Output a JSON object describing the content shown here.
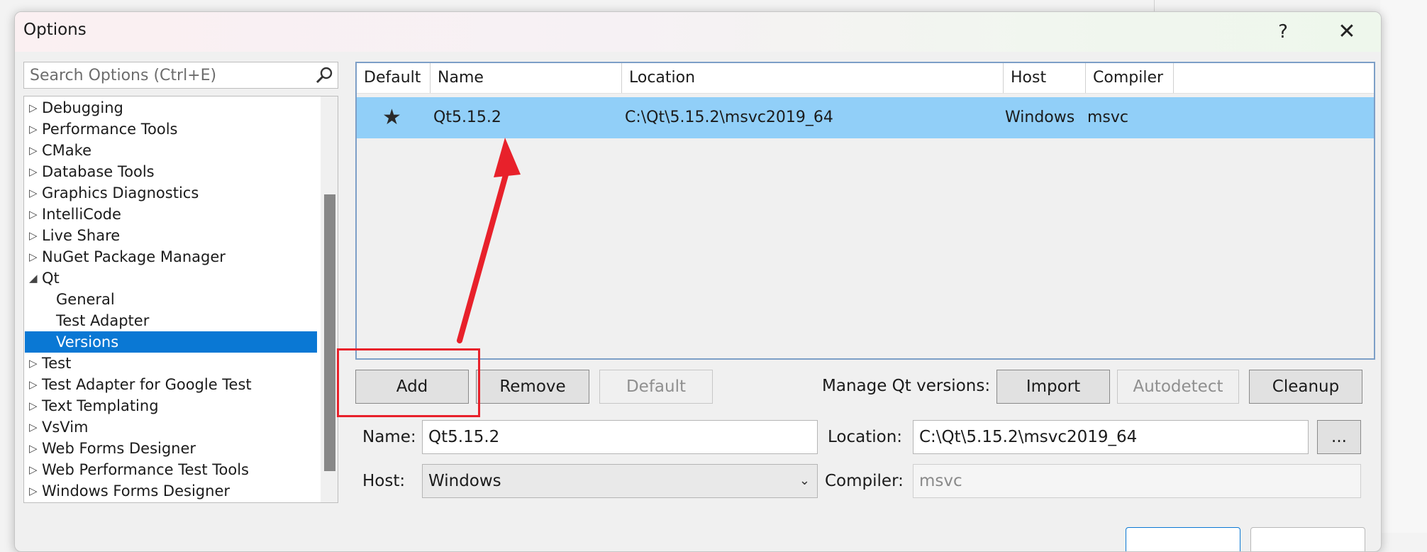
{
  "dialog": {
    "title": "Options",
    "help_label": "?",
    "close_label": "✕"
  },
  "search": {
    "placeholder": "Search Options (Ctrl+E)",
    "icon": "search-icon"
  },
  "tree": {
    "items": [
      {
        "label": "Debugging",
        "arrow": "▷",
        "level": 0
      },
      {
        "label": "Performance Tools",
        "arrow": "▷",
        "level": 0
      },
      {
        "label": "CMake",
        "arrow": "▷",
        "level": 0
      },
      {
        "label": "Database Tools",
        "arrow": "▷",
        "level": 0
      },
      {
        "label": "Graphics Diagnostics",
        "arrow": "▷",
        "level": 0
      },
      {
        "label": "IntelliCode",
        "arrow": "▷",
        "level": 0
      },
      {
        "label": "Live Share",
        "arrow": "▷",
        "level": 0
      },
      {
        "label": "NuGet Package Manager",
        "arrow": "▷",
        "level": 0
      },
      {
        "label": "Qt",
        "arrow": "◢",
        "level": 0
      },
      {
        "label": "General",
        "arrow": "",
        "level": 1
      },
      {
        "label": "Test Adapter",
        "arrow": "",
        "level": 1
      },
      {
        "label": "Versions",
        "arrow": "",
        "level": 1,
        "selected": true
      },
      {
        "label": "Test",
        "arrow": "▷",
        "level": 0
      },
      {
        "label": "Test Adapter for Google Test",
        "arrow": "▷",
        "level": 0
      },
      {
        "label": "Text Templating",
        "arrow": "▷",
        "level": 0
      },
      {
        "label": "VsVim",
        "arrow": "▷",
        "level": 0
      },
      {
        "label": "Web Forms Designer",
        "arrow": "▷",
        "level": 0
      },
      {
        "label": "Web Performance Test Tools",
        "arrow": "▷",
        "level": 0
      },
      {
        "label": "Windows Forms Designer",
        "arrow": "▷",
        "level": 0
      }
    ]
  },
  "grid": {
    "columns": [
      "Default",
      "Name",
      "Location",
      "Host",
      "Compiler"
    ],
    "rows": [
      {
        "default_icon": "★",
        "name": "Qt5.15.2",
        "location": "C:\\Qt\\5.15.2\\msvc2019_64",
        "host": "Windows",
        "compiler": "msvc"
      }
    ]
  },
  "buttons": {
    "add": "Add",
    "remove": "Remove",
    "default": "Default",
    "manage_label": "Manage Qt versions:",
    "import": "Import",
    "autodetect": "Autodetect",
    "cleanup": "Cleanup",
    "browse": "..."
  },
  "form": {
    "name_label": "Name:",
    "name_value": "Qt5.15.2",
    "location_label": "Location:",
    "location_value": "C:\\Qt\\5.15.2\\msvc2019_64",
    "host_label": "Host:",
    "host_value": "Windows",
    "compiler_label": "Compiler:",
    "compiler_value": "msvc"
  },
  "colors": {
    "selection": "#0a78d4",
    "row_highlight": "#91cff8",
    "annotation": "#e8212b"
  }
}
